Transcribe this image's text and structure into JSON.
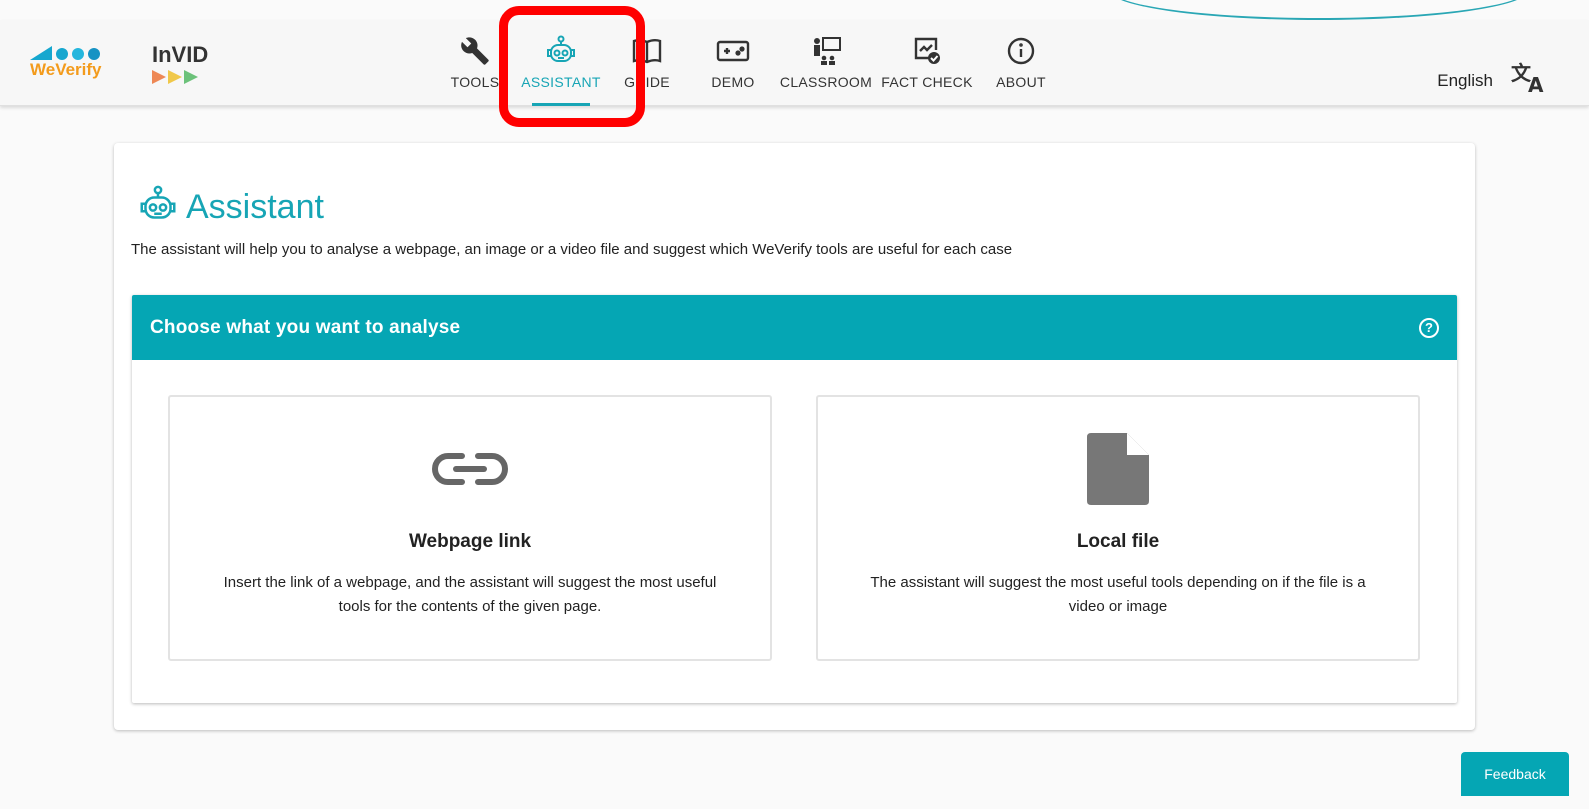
{
  "logos": {
    "weverify": "WeVerify",
    "invid": "InVID"
  },
  "nav": {
    "items": [
      {
        "label": "TOOLS",
        "icon": "wrench-icon",
        "active": false
      },
      {
        "label": "ASSISTANT",
        "icon": "robot-icon",
        "active": true
      },
      {
        "label": "GUIDE",
        "icon": "book-icon",
        "active": false
      },
      {
        "label": "DEMO",
        "icon": "gamepad-icon",
        "active": false
      },
      {
        "label": "CLASSROOM",
        "icon": "classroom-icon",
        "active": false
      },
      {
        "label": "FACT CHECK",
        "icon": "fact-check-icon",
        "active": false
      },
      {
        "label": "ABOUT",
        "icon": "info-icon",
        "active": false
      }
    ]
  },
  "language": {
    "label": "English",
    "icon": "translate-icon"
  },
  "page": {
    "title": "Assistant",
    "subtitle": "The assistant will help you to analyse a webpage, an image or a video file and suggest which WeVerify tools are useful for each case"
  },
  "panel": {
    "header": "Choose what you want to analyse",
    "options": [
      {
        "title": "Webpage link",
        "description": "Insert the link of a webpage, and the assistant will suggest the most useful tools for the contents of the given page.",
        "icon": "link-icon"
      },
      {
        "title": "Local file",
        "description": "The assistant will suggest the most useful tools depending on if the file is a video or image",
        "icon": "file-icon"
      }
    ]
  },
  "feedback": {
    "label": "Feedback"
  },
  "colors": {
    "accent": "#05a6b4",
    "highlight": "#ff0000"
  }
}
